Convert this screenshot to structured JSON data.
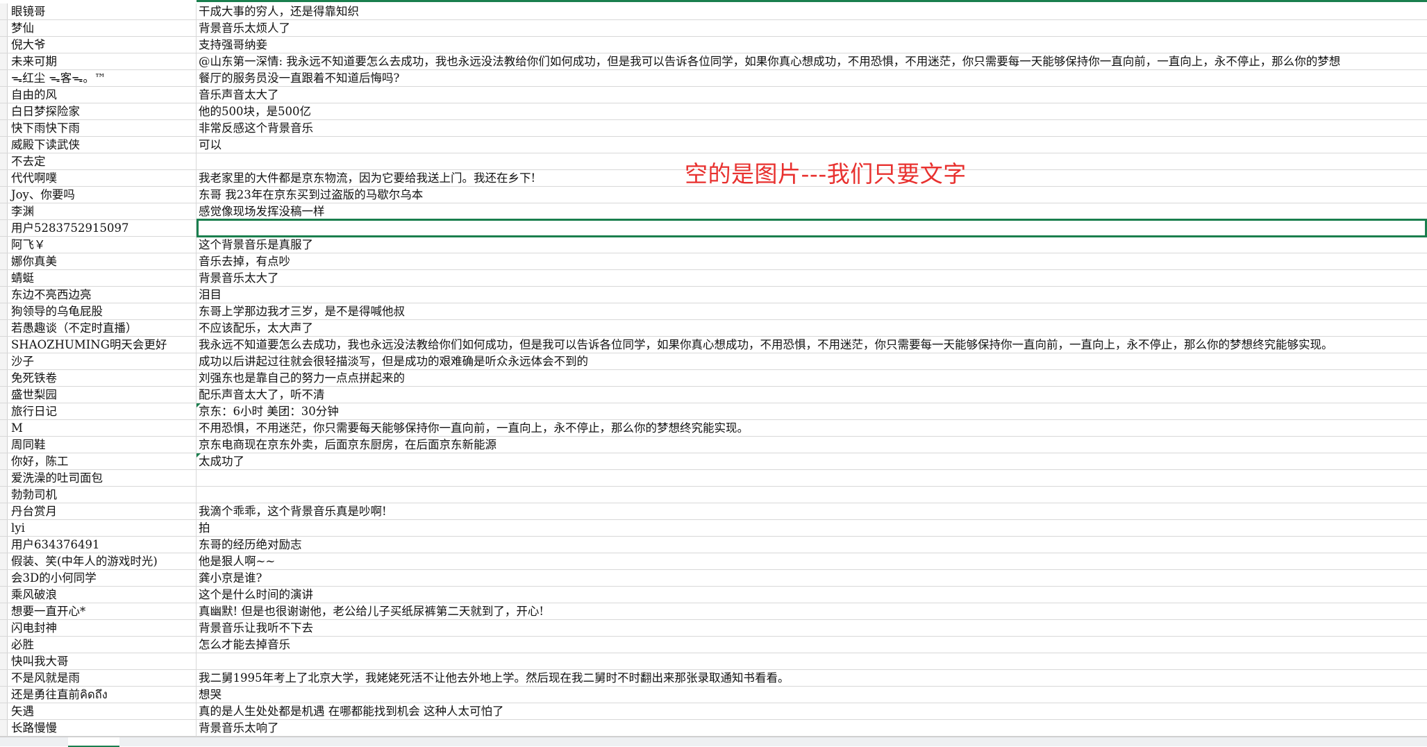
{
  "annotation": "空的是图片---我们只要文字",
  "rows": [
    {
      "user": "眼镜哥",
      "comment": "干成大事的穷人，还是得靠知织"
    },
    {
      "user": "梦仙",
      "comment": "背景音乐太烦人了"
    },
    {
      "user": "倪大爷",
      "comment": "支持强哥纳妾"
    },
    {
      "user": "未来可期",
      "comment": "@山东第一深情: 我永远不知道要怎么去成功，我也永远没法教给你们如何成功，但是我可以告诉各位同学，如果你真心想成功，不用恐惧，不用迷茫，你只需要每一天能够保持你一直向前，一直向上，永不停止，那么你的梦想"
    },
    {
      "user": "ᯓ红尘 ᯓ客ᯓ。™",
      "comment": "餐厅的服务员没一直跟着不知道后悔吗?"
    },
    {
      "user": "自由的风",
      "comment": "音乐声音太大了"
    },
    {
      "user": "白日梦探险家",
      "comment": "他的500块，是500亿"
    },
    {
      "user": "快下雨快下雨",
      "comment": "非常反感这个背景音乐"
    },
    {
      "user": "威殿下读武侠",
      "comment": "可以"
    },
    {
      "user": "不去定",
      "comment": ""
    },
    {
      "user": "代代啊噗",
      "comment": "我老家里的大件都是京东物流，因为它要给我送上门。我还在乡下!"
    },
    {
      "user": "Joy、你要吗",
      "comment": "东哥   我23年在京东买到过盗版的马歇尔乌本"
    },
    {
      "user": "李渊",
      "comment": "感觉像现场发挥没稿一样"
    },
    {
      "user": "用户5283752915097",
      "comment": ""
    },
    {
      "user": "阿飞￥",
      "comment": "这个背景音乐是真服了"
    },
    {
      "user": "娜你真美",
      "comment": "音乐去掉，有点吵"
    },
    {
      "user": "蜻蜓",
      "comment": "背景音乐太大了"
    },
    {
      "user": "东边不亮西边亮",
      "comment": "泪目"
    },
    {
      "user": "狗领导的乌龟屁股",
      "comment": "东哥上学那边我才三岁，是不是得喊他叔"
    },
    {
      "user": "若愚趣谈（不定时直播）",
      "comment": "不应该配乐，太大声了"
    },
    {
      "user": "SHAOZHUMING明天会更好",
      "comment": "我永远不知道要怎么去成功，我也永远没法教给你们如何成功，但是我可以告诉各位同学，如果你真心想成功，不用恐惧，不用迷茫，你只需要每一天能够保持你一直向前，一直向上，永不停止，那么你的梦想终究能够实现。"
    },
    {
      "user": "沙子",
      "comment": "成功以后讲起过往就会很轻描淡写，但是成功的艰难确是听众永远体会不到的"
    },
    {
      "user": "免死铁卷",
      "comment": "刘强东也是靠自己的努力一点点拼起来的"
    },
    {
      "user": "盛世梨园",
      "comment": "配乐声音太大了，听不清"
    },
    {
      "user": "旅行日记",
      "comment": "京东：6小时    美团：30分钟"
    },
    {
      "user": "M",
      "comment": "不用恐惧，不用迷茫，你只需要每天能够保持你一直向前，一直向上，永不停止，那么你的梦想终究能实现。"
    },
    {
      "user": "周同鞋",
      "comment": "京东电商现在京东外卖，后面京东厨房，在后面京东新能源"
    },
    {
      "user": "你好，陈工",
      "comment": "太成功了"
    },
    {
      "user": "爱洗澡的吐司面包",
      "comment": ""
    },
    {
      "user": "勃勃司机",
      "comment": ""
    },
    {
      "user": "丹台赏月",
      "comment": "我滴个乖乖，这个背景音乐真是吵啊!"
    },
    {
      "user": "lyi",
      "comment": "拍"
    },
    {
      "user": "用户634376491",
      "comment": "东哥的经历绝对励志"
    },
    {
      "user": "假装、笑(中年人的游戏时光)",
      "comment": "他是狠人啊~~"
    },
    {
      "user": "会3D的小何同学",
      "comment": "龚小京是谁?"
    },
    {
      "user": "乘风破浪",
      "comment": "这个是什么时间的演讲"
    },
    {
      "user": "想要一直开心*",
      "comment": "真幽默! 但是也很谢谢他，老公给儿子买纸尿裤第二天就到了，开心!"
    },
    {
      "user": "闪电封神",
      "comment": "背景音乐让我听不下去"
    },
    {
      "user": "必胜",
      "comment": "怎么才能去掉音乐"
    },
    {
      "user": "快叫我大哥",
      "comment": ""
    },
    {
      "user": "不是风就是雨",
      "comment": "我二舅1995年考上了北京大学，我姥姥死活不让他去外地上学。然后现在我二舅时不时翻出来那张录取通知书看看。"
    },
    {
      "user": "还是勇往直前คิดถึง",
      "comment": "想哭"
    },
    {
      "user": "矢遇",
      "comment": "真的是人生处处都是机遇 在哪都能找到机会   这种人太可怕了"
    },
    {
      "user": "长路慢慢",
      "comment": "背景音乐太响了"
    }
  ]
}
